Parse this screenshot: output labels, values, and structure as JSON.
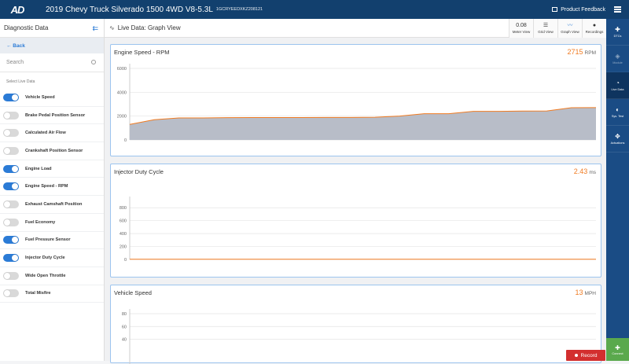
{
  "topbar": {
    "logo": "AD",
    "vehicle": "2019 Chevy Truck Silverado 1500 4WD V8-5.3L",
    "vin": "1GCRYEEDXKZ208121",
    "feedback_label": "Product Feedback"
  },
  "sidebar": {
    "title": "Diagnostic Data",
    "back_label": "← Back",
    "search_placeholder": "Search",
    "section_label": "Select Live Data",
    "items": [
      {
        "label": "Vehicle Speed",
        "on": true
      },
      {
        "label": "Brake Pedal Position Sensor",
        "on": false
      },
      {
        "label": "Calculated Air Flow",
        "on": false
      },
      {
        "label": "Crankshaft Position Sensor",
        "on": false
      },
      {
        "label": "Engine Load",
        "on": true
      },
      {
        "label": "Engine Speed - RPM",
        "on": true
      },
      {
        "label": "Exhaust Camshaft Position",
        "on": false
      },
      {
        "label": "Fuel Economy",
        "on": false
      },
      {
        "label": "Fuel Pressure Sensor",
        "on": true
      },
      {
        "label": "Injector Duty Cycle",
        "on": true
      },
      {
        "label": "Wide Open Throttle",
        "on": false
      },
      {
        "label": "Total Misfire",
        "on": false
      }
    ]
  },
  "main": {
    "title": "Live Data: Graph View",
    "views": [
      {
        "label": "Meter View",
        "icon": "0.08"
      },
      {
        "label": "Grid View",
        "icon": "☰"
      },
      {
        "label": "Graph View",
        "icon": "〰"
      },
      {
        "label": "Recordings",
        "icon": "●"
      }
    ],
    "record_label": "Record"
  },
  "rightbar": {
    "items": [
      {
        "label": "DTCs",
        "icon": "✚"
      },
      {
        "label": "Module",
        "icon": "◈"
      },
      {
        "label": "Live Data",
        "icon": "◔"
      },
      {
        "label": "Sys. Test",
        "icon": "◐"
      },
      {
        "label": "Actuations",
        "icon": "✥"
      }
    ],
    "connect_label": "Connect"
  },
  "colors": {
    "accent": "#2b7bd6",
    "brand": "#12406e",
    "value": "#f07b22",
    "record": "#d32f2f",
    "connect": "#5aa94d"
  },
  "chart_data": [
    {
      "type": "area",
      "title": "Engine Speed - RPM",
      "current_value": "2715",
      "unit": "RPM",
      "ylim": [
        0,
        6000
      ],
      "yticks": [
        0,
        2000,
        4000,
        6000
      ],
      "values": [
        1300,
        1700,
        1850,
        1850,
        1870,
        1880,
        1880,
        1880,
        1890,
        1890,
        1900,
        2000,
        2200,
        2200,
        2400,
        2400,
        2420,
        2430,
        2700,
        2715
      ]
    },
    {
      "type": "line",
      "title": "Injector Duty Cycle",
      "current_value": "2.43",
      "unit": "ms",
      "ylim": [
        0,
        900
      ],
      "yticks": [
        0,
        200,
        400,
        600,
        800
      ],
      "values": [
        2.4,
        2.4,
        2.4,
        2.4,
        2.4,
        2.4,
        2.4,
        2.4,
        2.4,
        2.4,
        2.4,
        2.4,
        2.4,
        2.4,
        2.4,
        2.4,
        2.4,
        2.4,
        2.43,
        2.43
      ]
    },
    {
      "type": "line",
      "title": "Vehicle Speed",
      "current_value": "13",
      "unit": "MPH",
      "ylim": [
        0,
        80
      ],
      "yticks": [
        40,
        60,
        80
      ],
      "values": []
    }
  ]
}
